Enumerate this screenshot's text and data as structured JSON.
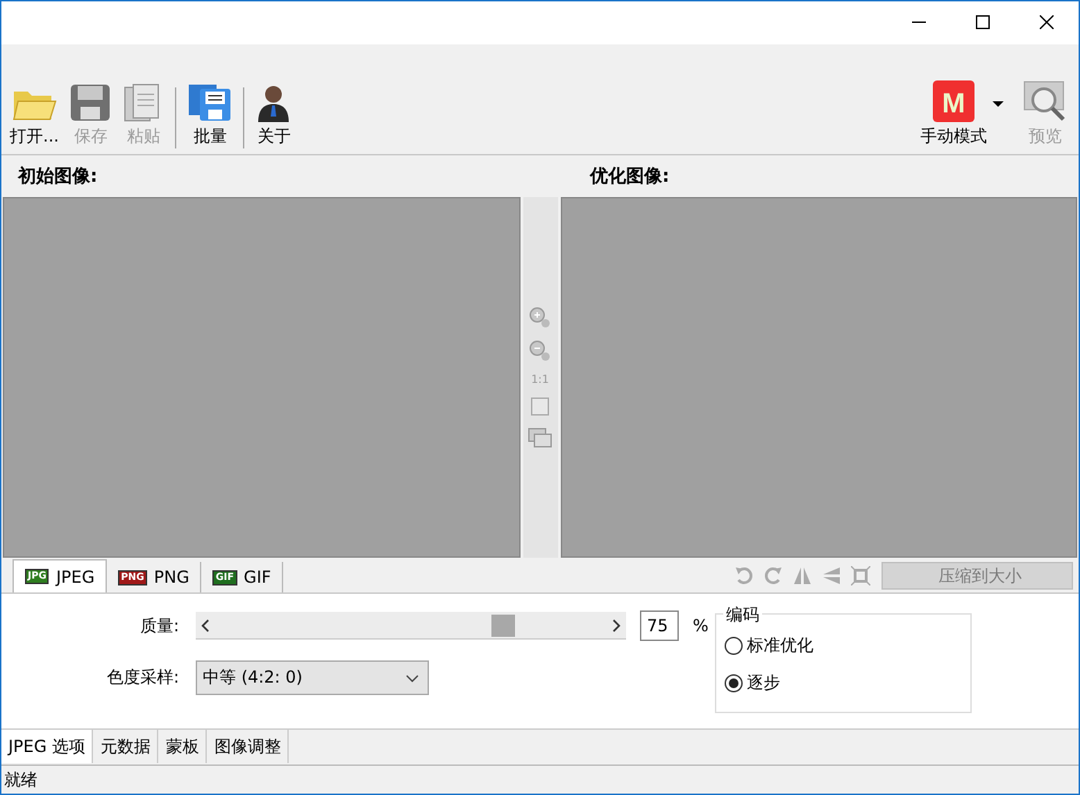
{
  "toolbar": {
    "left": [
      {
        "label": "打开...",
        "kind": "folder",
        "disabled": false
      },
      {
        "label": "保存",
        "kind": "disk",
        "disabled": true
      },
      {
        "label": "粘贴",
        "kind": "paste",
        "disabled": true
      },
      {
        "kind": "separator"
      },
      {
        "label": "批量",
        "kind": "batch",
        "disabled": false
      },
      {
        "kind": "separator"
      },
      {
        "label": "关于",
        "kind": "person",
        "disabled": false
      }
    ],
    "mode": {
      "label": "手动模式",
      "badge": "M"
    },
    "preview": {
      "label": "预览",
      "disabled": true
    }
  },
  "panels": {
    "original": "初始图像:",
    "optimized": "优化图像:"
  },
  "side_tools": [
    {
      "kind": "zoom-in"
    },
    {
      "kind": "zoom-out"
    },
    {
      "kind": "text",
      "label": "1:1"
    },
    {
      "kind": "fit"
    },
    {
      "kind": "compare"
    }
  ],
  "format_tabs": [
    {
      "label": "JPEG",
      "icon": "JPG",
      "color": "#2e7d1f",
      "selected": true
    },
    {
      "label": "PNG",
      "icon": "PNG",
      "color": "#a01818",
      "selected": false
    },
    {
      "label": "GIF",
      "icon": "GIF",
      "color": "#1f6e1f",
      "selected": false
    }
  ],
  "compress_button": {
    "label": "压缩到大小",
    "disabled": true
  },
  "quality": {
    "label": "质量:",
    "level": 0.75,
    "value": "75",
    "unit": "%"
  },
  "chroma": {
    "label": "色度采样:",
    "value": "中等 (4:2: 0)"
  },
  "encoding": {
    "title": "编码",
    "options": [
      {
        "label": "标准优化",
        "selected": false
      },
      {
        "label": "逐步",
        "selected": true
      }
    ]
  },
  "bottom_tabs": [
    {
      "label": "JPEG 选项",
      "selected": true
    },
    {
      "label": "元数据",
      "selected": false
    },
    {
      "label": "蒙板",
      "selected": false
    },
    {
      "label": "图像调整",
      "selected": false
    }
  ],
  "status_bar": {
    "text": "就绪"
  }
}
